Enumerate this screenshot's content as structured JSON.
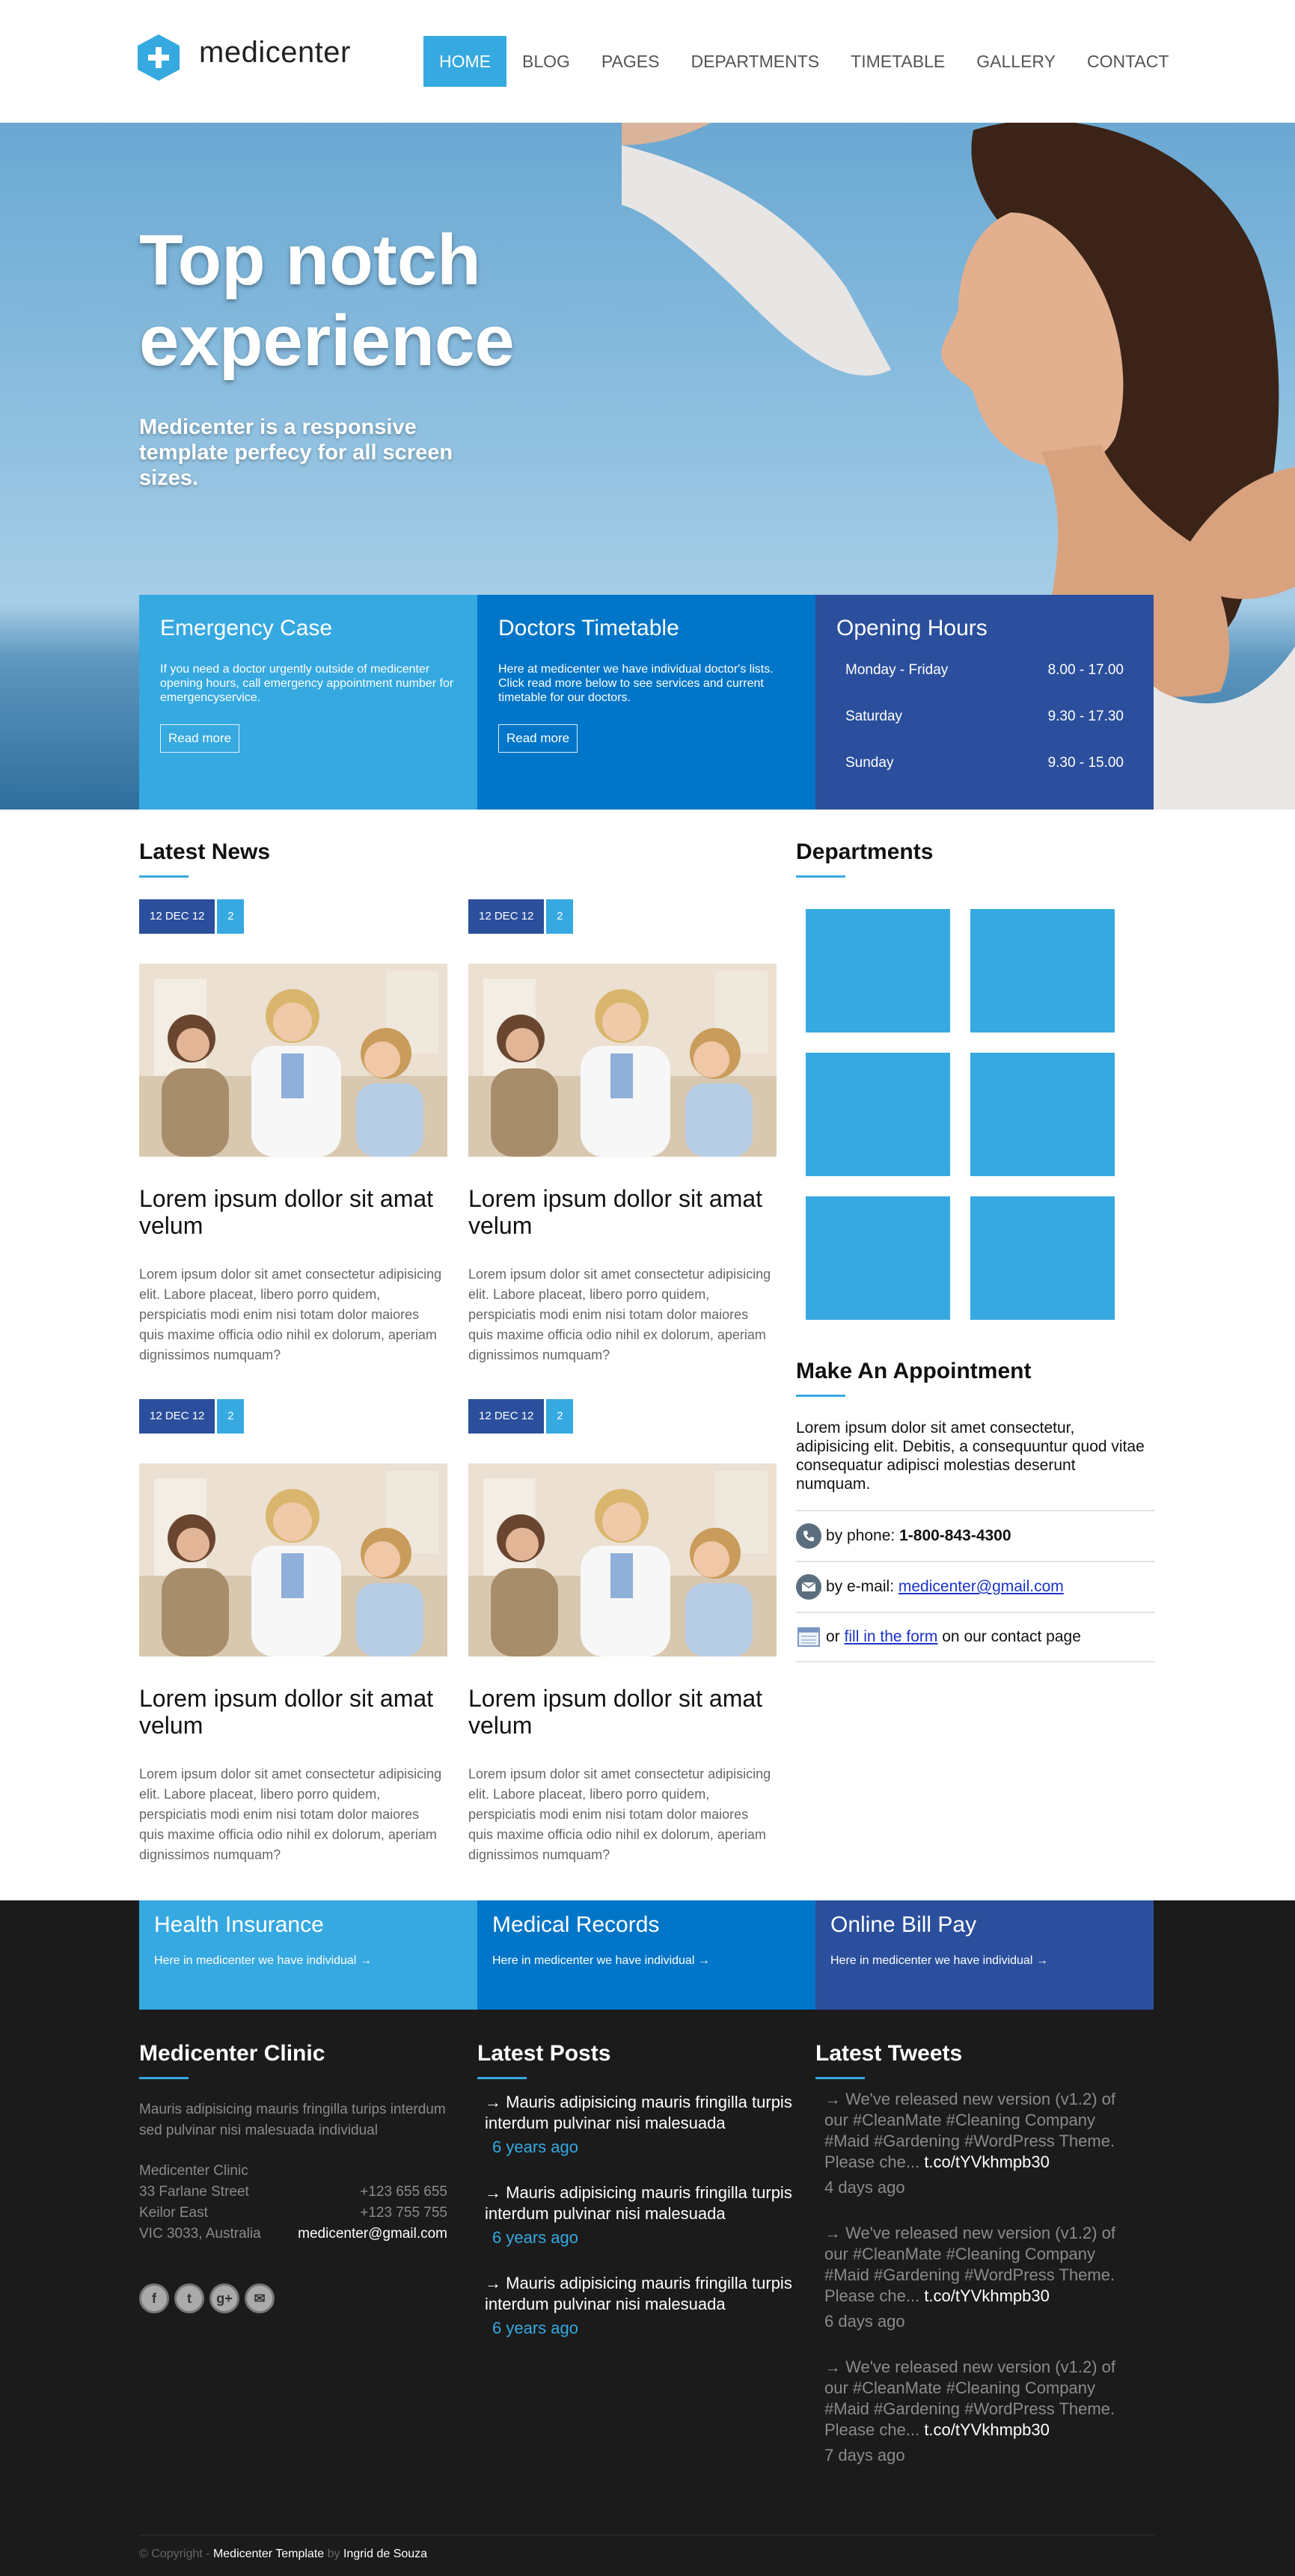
{
  "brand": {
    "name": "medicenter",
    "accent": "#36a9e1",
    "dark_blue": "#2b4f9c",
    "mid_blue": "#0176c8"
  },
  "nav": [
    "HOME",
    "BLOG",
    "PAGES",
    "DEPARTMENTS",
    "TIMETABLE",
    "GALLERY",
    "CONTACT"
  ],
  "hero": {
    "title": "Top notch experience",
    "subtitle": "Medicenter is a responsive template perfecy for all screen sizes.",
    "boxes": [
      {
        "title": "Emergency Case",
        "text": "If you need a doctor urgently outside of medicenter opening hours, call emergency appointment number for emergencyservice.",
        "button": "Read more"
      },
      {
        "title": "Doctors Timetable",
        "text": "Here at medicenter we have individual doctor's lists. Click read more below to see services and current timetable for our doctors.",
        "button": "Read more"
      },
      {
        "title": "Opening Hours",
        "rows": [
          {
            "day": "Monday - Friday",
            "time": "8.00 - 17.00"
          },
          {
            "day": "Saturday",
            "time": "9.30 - 17.30"
          },
          {
            "day": "Sunday",
            "time": "9.30 - 15.00"
          }
        ]
      }
    ]
  },
  "latest_news": {
    "title": "Latest News",
    "items": [
      {
        "date": "12 DEC 12",
        "count": "2",
        "title": "Lorem ipsum dollor sit amat velum",
        "text": "Lorem ipsum dolor sit amet consectetur adipisicing elit. Labore placeat, libero porro quidem, perspiciatis modi enim nisi totam dolor maiores quis maxime officia odio nihil ex dolorum, aperiam dignissimos numquam?"
      },
      {
        "date": "12 DEC 12",
        "count": "2",
        "title": "Lorem ipsum dollor sit amat velum",
        "text": "Lorem ipsum dolor sit amet consectetur adipisicing elit. Labore placeat, libero porro quidem, perspiciatis modi enim nisi totam dolor maiores quis maxime officia odio nihil ex dolorum, aperiam dignissimos numquam?"
      },
      {
        "date": "12 DEC 12",
        "count": "2",
        "title": "Lorem ipsum dollor sit amat velum",
        "text": "Lorem ipsum dolor sit amet consectetur adipisicing elit. Labore placeat, libero porro quidem, perspiciatis modi enim nisi totam dolor maiores quis maxime officia odio nihil ex dolorum, aperiam dignissimos numquam?"
      },
      {
        "date": "12 DEC 12",
        "count": "2",
        "title": "Lorem ipsum dollor sit amat velum",
        "text": "Lorem ipsum dolor sit amet consectetur adipisicing elit. Labore placeat, libero porro quidem, perspiciatis modi enim nisi totam dolor maiores quis maxime officia odio nihil ex dolorum, aperiam dignissimos numquam?"
      }
    ]
  },
  "departments": {
    "title": "Departments"
  },
  "appointment": {
    "title": "Make An Appointment",
    "text": "Lorem ipsum dolor sit amet consectetur, adipisicing elit. Debitis, a consequuntur quod vitae consequatur adipisci molestias deserunt numquam.",
    "phone_prefix": "by phone:",
    "phone": "1-800-843-4300",
    "email_prefix": "by e-mail:",
    "email": "medicenter@gmail.com",
    "form_prefix": "or",
    "form_link": "fill in the form",
    "form_suffix": "on our contact page"
  },
  "footer_boxes": [
    {
      "title": "Health Insurance",
      "text": "Here in medicenter we have individual →"
    },
    {
      "title": "Medical Records",
      "text": "Here in medicenter we have individual →"
    },
    {
      "title": "Online Bill Pay",
      "text": "Here in medicenter we have individual →"
    }
  ],
  "clinic": {
    "title": "Medicenter Clinic",
    "text": "Mauris adipisicing mauris fringilla turips interdum sed pulvinar nisi malesuada individual",
    "address": [
      "Medicenter Clinic",
      "33 Farlane Street",
      "Keilor East",
      "VIC 3033, Australia"
    ],
    "phones": [
      "+123 655 655",
      "+123 755 755"
    ],
    "email": "medicenter@gmail.com"
  },
  "latest_posts": {
    "title": "Latest Posts",
    "items": [
      {
        "text": "Mauris adipisicing mauris fringilla turpis interdum pulvinar nisi malesuada",
        "time": "6 years ago"
      },
      {
        "text": "Mauris adipisicing mauris fringilla turpis interdum pulvinar nisi malesuada",
        "time": "6 years ago"
      },
      {
        "text": "Mauris adipisicing mauris fringilla turpis interdum pulvinar nisi malesuada",
        "time": "6 years ago"
      }
    ]
  },
  "latest_tweets": {
    "title": "Latest Tweets",
    "items": [
      {
        "text": "We've released new version (v1.2) of our #CleanMate #Cleaning Company #Maid #Gardening #WordPress Theme. Please che...",
        "link": "t.co/tYVkhmpb30",
        "time": "4 days ago"
      },
      {
        "text": "We've released new version (v1.2) of our #CleanMate #Cleaning Company #Maid #Gardening #WordPress Theme. Please che...",
        "link": "t.co/tYVkhmpb30",
        "time": "6 days ago"
      },
      {
        "text": "We've released new version (v1.2) of our #CleanMate #Cleaning Company #Maid #Gardening #WordPress Theme. Please che...",
        "link": "t.co/tYVkhmpb30",
        "time": "7 days ago"
      }
    ]
  },
  "social_icons": [
    "facebook-icon",
    "twitter-icon",
    "googleplus-icon",
    "mail-icon"
  ],
  "social_glyphs": [
    "f",
    "t",
    "g+",
    "✉"
  ],
  "copyright": {
    "prefix": "© Copyright -",
    "template": "Medicenter Template",
    "by": "by",
    "author": "Ingrid de Souza"
  }
}
